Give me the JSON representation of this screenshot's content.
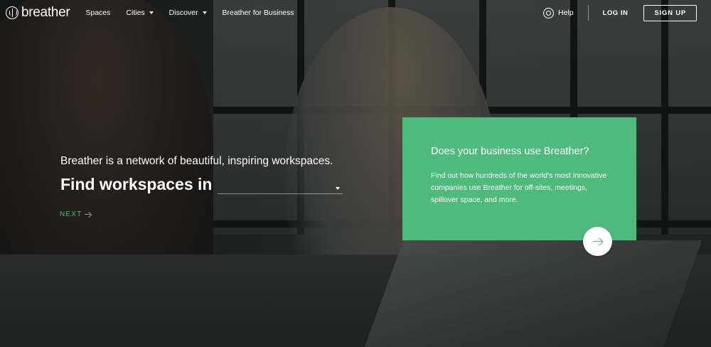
{
  "colors": {
    "accent": "#4fba7c",
    "text": "#ffffff"
  },
  "nav": {
    "logo_text": "breather",
    "logo_icon": "tree-icon",
    "items": [
      {
        "label": "Spaces",
        "has_dropdown": false
      },
      {
        "label": "Cities",
        "has_dropdown": true
      },
      {
        "label": "Discover",
        "has_dropdown": true
      },
      {
        "label": "Breather for Business",
        "has_dropdown": false
      }
    ],
    "help_label": "Help",
    "login_label": "LOG IN",
    "signup_label": "SIGN UP"
  },
  "hero": {
    "tagline": "Breather is a network of beautiful, inspiring workspaces.",
    "find_label": "Find workspaces in",
    "city_value": "",
    "next_label": "NEXT"
  },
  "card": {
    "title": "Does your business use Breather?",
    "body": "Find out how hundreds of the world's most innovative companies use Breather for off-sites, meetings, spillover space, and more."
  }
}
